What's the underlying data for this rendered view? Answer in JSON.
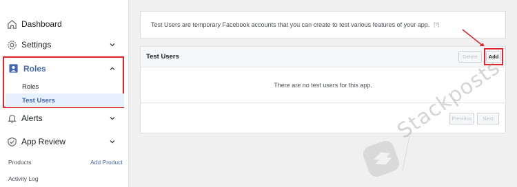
{
  "sidebar": {
    "dashboard_label": "Dashboard",
    "settings_label": "Settings",
    "roles_label": "Roles",
    "roles_sub": [
      "Roles",
      "Test Users"
    ],
    "alerts_label": "Alerts",
    "app_review_label": "App Review",
    "products_label": "Products",
    "add_product_label": "Add Product",
    "activity_log_label": "Activity Log"
  },
  "intro": {
    "text": "Test Users are temporary Facebook accounts that you can create to test various features of your app.",
    "help": "[?]"
  },
  "test_users": {
    "title": "Test Users",
    "delete_label": "Delete",
    "add_label": "Add",
    "empty_message": "There are no test users for this app.",
    "previous_label": "Previous",
    "next_label": "Next"
  },
  "watermark": {
    "text": "Stackposts"
  },
  "colors": {
    "accent": "#4267b2",
    "highlight": "#e0242a",
    "active_bg": "#e7f0fd"
  }
}
